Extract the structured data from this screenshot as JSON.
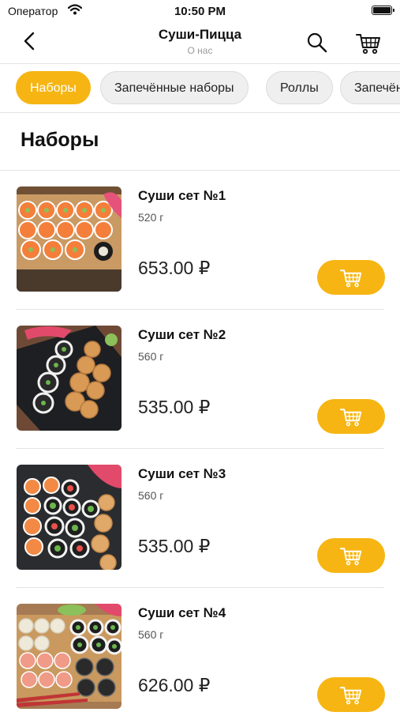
{
  "status_bar": {
    "carrier": "Оператор",
    "time": "10:50 PM"
  },
  "nav": {
    "title": "Суши-Пицца",
    "subtitle": "О нас"
  },
  "categories": [
    {
      "label": "Наборы",
      "active": true
    },
    {
      "label": "Запечённые наборы",
      "active": false
    },
    {
      "label": "Роллы",
      "active": false
    },
    {
      "label": "Запечённые роллы",
      "active": false
    }
  ],
  "section": {
    "title": "Наборы"
  },
  "products": [
    {
      "name": "Суши сет №1",
      "weight": "520 г",
      "price": "653.00 ₽"
    },
    {
      "name": "Суши сет №2",
      "weight": "560 г",
      "price": "535.00 ₽"
    },
    {
      "name": "Суши сет №3",
      "weight": "560 г",
      "price": "535.00 ₽"
    },
    {
      "name": "Суши сет №4",
      "weight": "560 г",
      "price": "626.00 ₽"
    }
  ],
  "colors": {
    "accent": "#f6b513",
    "divider": "#e4e4e4",
    "chip_bg": "#efefef"
  },
  "icons": {
    "back": "chevron-left-icon",
    "search": "search-icon",
    "cart": "cart-icon"
  }
}
